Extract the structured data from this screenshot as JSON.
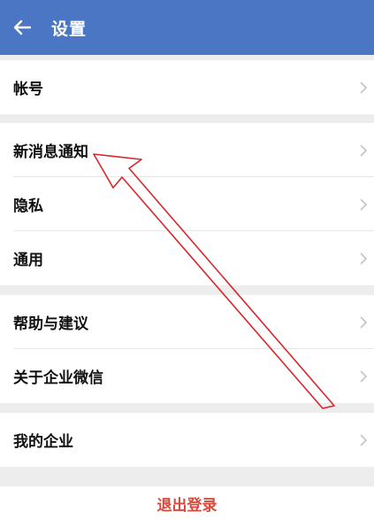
{
  "header": {
    "title": "设置",
    "back_icon": "arrow-left-icon",
    "background": "#4a76c4"
  },
  "sections": [
    {
      "items": [
        {
          "label": "帐号"
        }
      ]
    },
    {
      "items": [
        {
          "label": "新消息通知"
        },
        {
          "label": "隐私"
        },
        {
          "label": "通用"
        }
      ]
    },
    {
      "items": [
        {
          "label": "帮助与建议"
        },
        {
          "label": "关于企业微信"
        }
      ]
    },
    {
      "items": [
        {
          "label": "我的企业",
          "value": "ㅤㅤㅤ"
        }
      ]
    }
  ],
  "logout": {
    "label": "退出登录",
    "color": "#d84a3b"
  },
  "chevron_icon": "chevron-right-icon",
  "annotation": {
    "icon": "red-arrow-annotation",
    "color": "#d9262b"
  }
}
